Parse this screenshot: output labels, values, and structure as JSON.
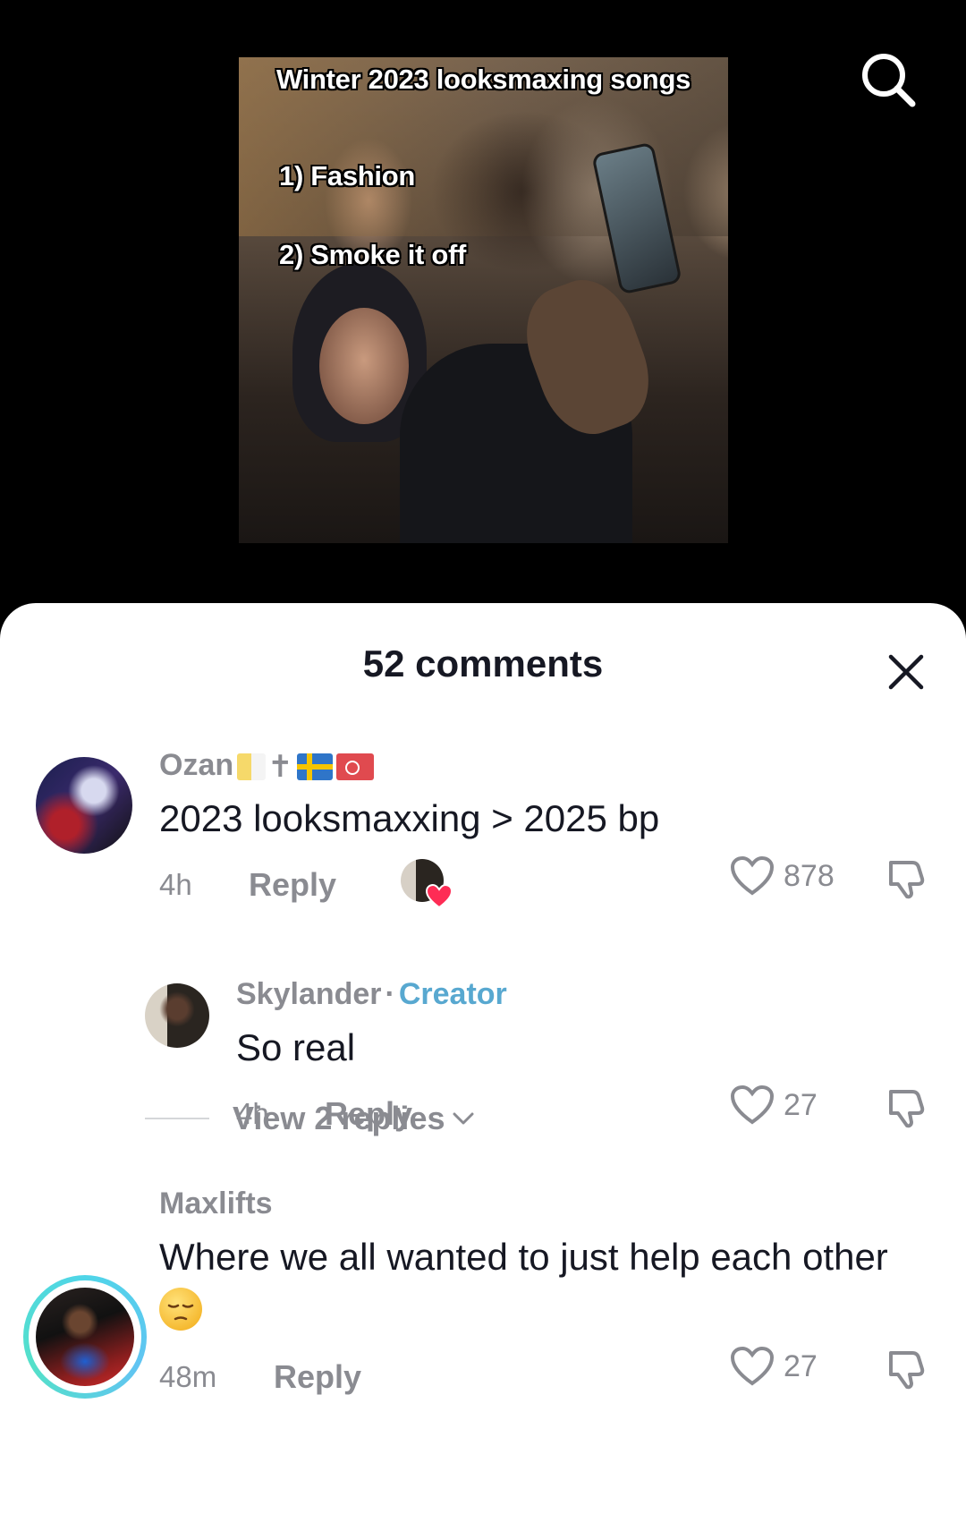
{
  "video": {
    "overlay_title": "Winter 2023 looksmaxing songs",
    "overlay_line_1": "1) Fashion",
    "overlay_line_2": "2) Smoke it off"
  },
  "header": {
    "search_icon": "search-icon"
  },
  "comments_sheet": {
    "title": "52 comments",
    "close_icon": "close-icon"
  },
  "comments": [
    {
      "username": "Ozan",
      "badges": [
        "vatican-flag",
        "cross",
        "sweden-flag",
        "turkey-flag"
      ],
      "text": "2023 looksmaxxing > 2025 bp",
      "time": "4h",
      "reply_label": "Reply",
      "likes": "878",
      "liked_by_creator": true
    },
    {
      "username": "Skylander",
      "role": "Creator",
      "separator": "·",
      "text": "So real",
      "time": "4h",
      "reply_label": "Reply",
      "likes": "27"
    },
    {
      "username": "Maxlifts",
      "text": "Where we all wanted to just help each other",
      "emoji": "pensive-face",
      "time": "48m",
      "reply_label": "Reply",
      "likes": "27"
    }
  ],
  "view_replies": {
    "label": "View 2 replies"
  },
  "colors": {
    "sheet_bg": "#ffffff",
    "creator": "#58a8d0",
    "muted": "#8a8b91",
    "heart_red": "#fe2c55",
    "story_ring": "#4fd5e8"
  }
}
